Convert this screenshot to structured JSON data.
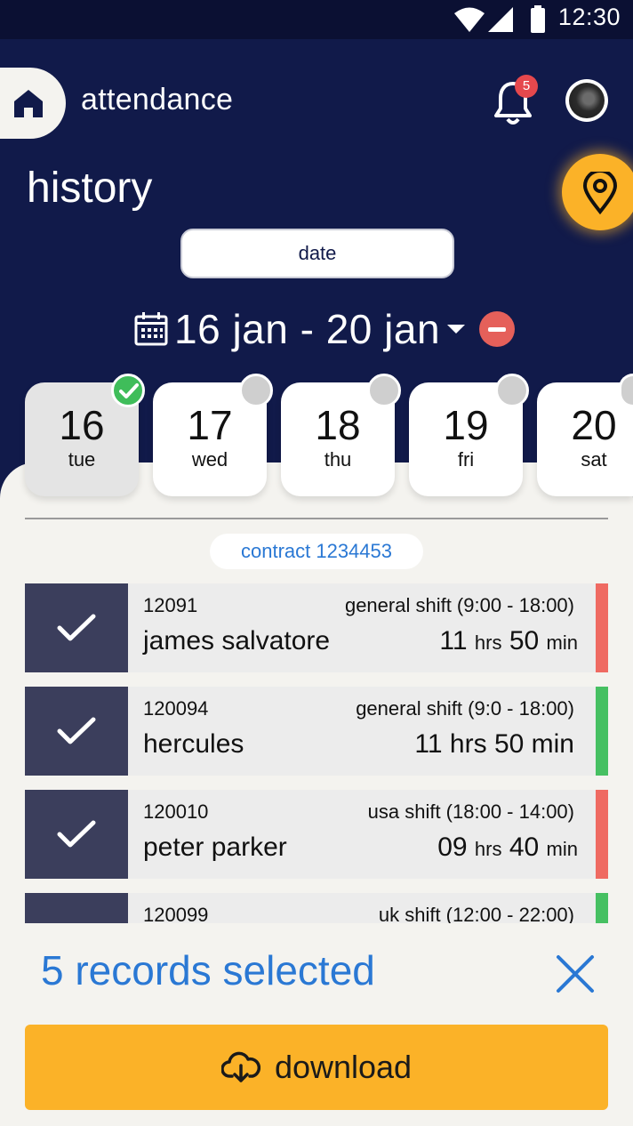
{
  "status_bar": {
    "time": "12:30"
  },
  "header": {
    "app_title": "attendance",
    "notification_count": "5",
    "page_title": "history",
    "date_button_label": "date",
    "date_range": "16 jan - 20 jan"
  },
  "days": [
    {
      "num": "16",
      "name": "tue",
      "selected": true,
      "checked": true
    },
    {
      "num": "17",
      "name": "wed",
      "selected": false,
      "checked": false
    },
    {
      "num": "18",
      "name": "thu",
      "selected": false,
      "checked": false
    },
    {
      "num": "19",
      "name": "fri",
      "selected": false,
      "checked": false
    },
    {
      "num": "20",
      "name": "sat",
      "selected": false,
      "checked": false
    }
  ],
  "contract_label": "contract 1234453",
  "records": [
    {
      "id": "12091",
      "shift": "general shift (9:00 - 18:00)",
      "name": "james salvatore",
      "hours": "11",
      "hrs_label": "hrs",
      "minutes": "50",
      "min_label": "min",
      "status_color": "#ef6a62"
    },
    {
      "id": "120094",
      "shift": "general shift (9:0 - 18:00)",
      "name": "hercules",
      "hours": "11",
      "hrs_label": "hrs",
      "minutes": "50",
      "min_label": "min",
      "status_color": "#46c062"
    },
    {
      "id": "120010",
      "shift": "usa shift (18:00 - 14:00)",
      "name": "peter parker",
      "hours": "09",
      "hrs_label": "hrs",
      "minutes": "40",
      "min_label": "min",
      "status_color": "#ef6a62"
    },
    {
      "id": "120099",
      "shift": "uk shift (12:00 - 22:00)",
      "name": "",
      "hours": "",
      "hrs_label": "",
      "minutes": "",
      "min_label": "",
      "status_color": "#46c062"
    }
  ],
  "selection": {
    "summary": "5 records selected",
    "download_label": "download"
  },
  "colors": {
    "header_bg": "#111a4a",
    "accent": "#fbb228",
    "link_blue": "#2a78d4",
    "check_green": "#3fbd5a"
  }
}
